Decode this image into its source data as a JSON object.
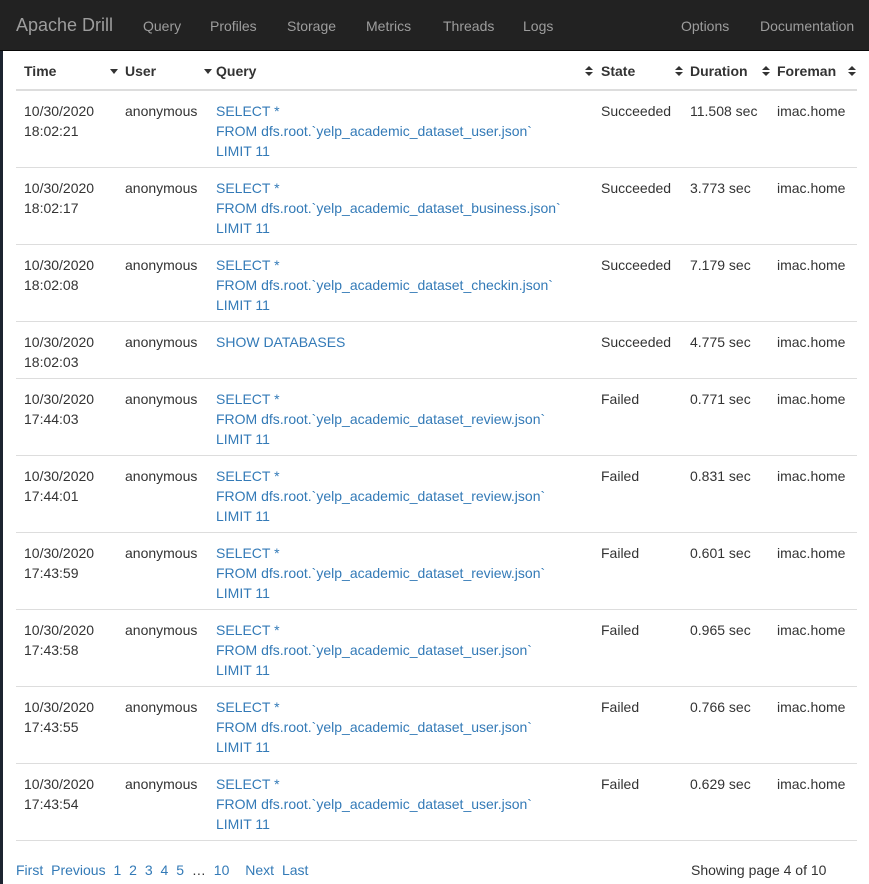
{
  "navbar": {
    "brand": "Apache Drill",
    "links": [
      "Query",
      "Profiles",
      "Storage",
      "Metrics",
      "Threads",
      "Logs"
    ],
    "right_links": [
      "Options",
      "Documentation"
    ]
  },
  "table": {
    "headers": {
      "time": "Time",
      "user": "User",
      "query": "Query",
      "state": "State",
      "duration": "Duration",
      "foreman": "Foreman"
    },
    "rows": [
      {
        "date": "10/30/2020",
        "time": "18:02:21",
        "user": "anonymous",
        "query": [
          "SELECT *",
          "FROM dfs.root.`yelp_academic_dataset_user.json`",
          "LIMIT 11"
        ],
        "state": "Succeeded",
        "duration": "11.508 sec",
        "foreman": "imac.home"
      },
      {
        "date": "10/30/2020",
        "time": "18:02:17",
        "user": "anonymous",
        "query": [
          "SELECT *",
          "FROM dfs.root.`yelp_academic_dataset_business.json`",
          "LIMIT 11"
        ],
        "state": "Succeeded",
        "duration": "3.773 sec",
        "foreman": "imac.home"
      },
      {
        "date": "10/30/2020",
        "time": "18:02:08",
        "user": "anonymous",
        "query": [
          "SELECT *",
          "FROM dfs.root.`yelp_academic_dataset_checkin.json`",
          "LIMIT 11"
        ],
        "state": "Succeeded",
        "duration": "7.179 sec",
        "foreman": "imac.home"
      },
      {
        "date": "10/30/2020",
        "time": "18:02:03",
        "user": "anonymous",
        "query": [
          "SHOW DATABASES"
        ],
        "state": "Succeeded",
        "duration": "4.775 sec",
        "foreman": "imac.home"
      },
      {
        "date": "10/30/2020",
        "time": "17:44:03",
        "user": "anonymous",
        "query": [
          "SELECT *",
          "FROM dfs.root.`yelp_academic_dataset_review.json`",
          "LIMIT 11"
        ],
        "state": "Failed",
        "duration": "0.771 sec",
        "foreman": "imac.home"
      },
      {
        "date": "10/30/2020",
        "time": "17:44:01",
        "user": "anonymous",
        "query": [
          "SELECT *",
          "FROM dfs.root.`yelp_academic_dataset_review.json`",
          "LIMIT 11"
        ],
        "state": "Failed",
        "duration": "0.831 sec",
        "foreman": "imac.home"
      },
      {
        "date": "10/30/2020",
        "time": "17:43:59",
        "user": "anonymous",
        "query": [
          "SELECT *",
          "FROM dfs.root.`yelp_academic_dataset_review.json`",
          "LIMIT 11"
        ],
        "state": "Failed",
        "duration": "0.601 sec",
        "foreman": "imac.home"
      },
      {
        "date": "10/30/2020",
        "time": "17:43:58",
        "user": "anonymous",
        "query": [
          "SELECT *",
          "FROM dfs.root.`yelp_academic_dataset_user.json`",
          "LIMIT 11"
        ],
        "state": "Failed",
        "duration": "0.965 sec",
        "foreman": "imac.home"
      },
      {
        "date": "10/30/2020",
        "time": "17:43:55",
        "user": "anonymous",
        "query": [
          "SELECT *",
          "FROM dfs.root.`yelp_academic_dataset_user.json`",
          "LIMIT 11"
        ],
        "state": "Failed",
        "duration": "0.766 sec",
        "foreman": "imac.home"
      },
      {
        "date": "10/30/2020",
        "time": "17:43:54",
        "user": "anonymous",
        "query": [
          "SELECT *",
          "FROM dfs.root.`yelp_academic_dataset_user.json`",
          "LIMIT 11"
        ],
        "state": "Failed",
        "duration": "0.629 sec",
        "foreman": "imac.home"
      }
    ]
  },
  "pagination": {
    "first": "First",
    "previous": "Previous",
    "pages": [
      "1",
      "2",
      "3",
      "4",
      "5"
    ],
    "ellipsis": "…",
    "last_page": "10",
    "next": "Next",
    "last": "Last",
    "status": "Showing page 4 of 10"
  },
  "colors": {
    "navbar": "#222222",
    "link": "#337ab7",
    "text": "#333333",
    "nav_text": "#9d9d9d"
  }
}
